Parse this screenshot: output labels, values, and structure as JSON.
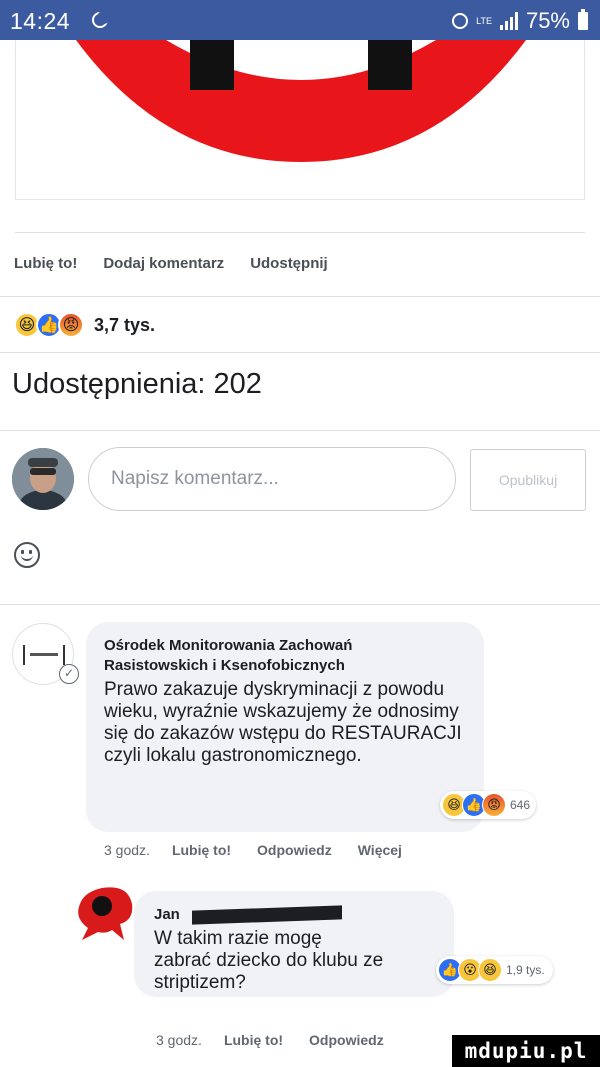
{
  "status_bar": {
    "time": "14:24",
    "network": "LTE",
    "battery": "75%"
  },
  "post_actions": {
    "like": "Lubię to!",
    "comment": "Dodaj komentarz",
    "share": "Udostępnij"
  },
  "reactions": {
    "count": "3,7 tys."
  },
  "shares": {
    "text": "Udostępnienia: 202"
  },
  "composer": {
    "placeholder": "Napisz komentarz...",
    "publish_label": "Opublikuj"
  },
  "comments": [
    {
      "author": "Ośrodek Monitorowania Zachowań Rasistowskich i Ksenofobicznych",
      "text": "Prawo zakazuje dyskryminacji z powodu wieku, wyraźnie wskazujemy że odnosimy się do zakazów wstępu do RESTAURACJI czyli lokalu gastronomicznego.",
      "reaction_count": "646",
      "time": "3 godz.",
      "like": "Lubię to!",
      "reply": "Odpowiedz",
      "more": "Więcej"
    },
    {
      "author": "Jan",
      "text": "W takim razie mogę zabrać dziecko do klubu ze striptizem?",
      "reaction_count": "1,9 tys.",
      "time": "3 godz.",
      "like": "Lubię to!",
      "reply": "Odpowiedz"
    }
  ],
  "watermark": {
    "text": "mdupiu.pl"
  },
  "colors": {
    "status_bar": "#3b5aa0",
    "stop_sign": "#e8151b",
    "like_blue": "#2c6ff5"
  },
  "icons": [
    "moon-icon",
    "alarm-icon",
    "signal-icon",
    "battery-icon",
    "haha-emoji-icon",
    "like-emoji-icon",
    "angry-emoji-icon",
    "smiley-icon",
    "verified-icon"
  ]
}
